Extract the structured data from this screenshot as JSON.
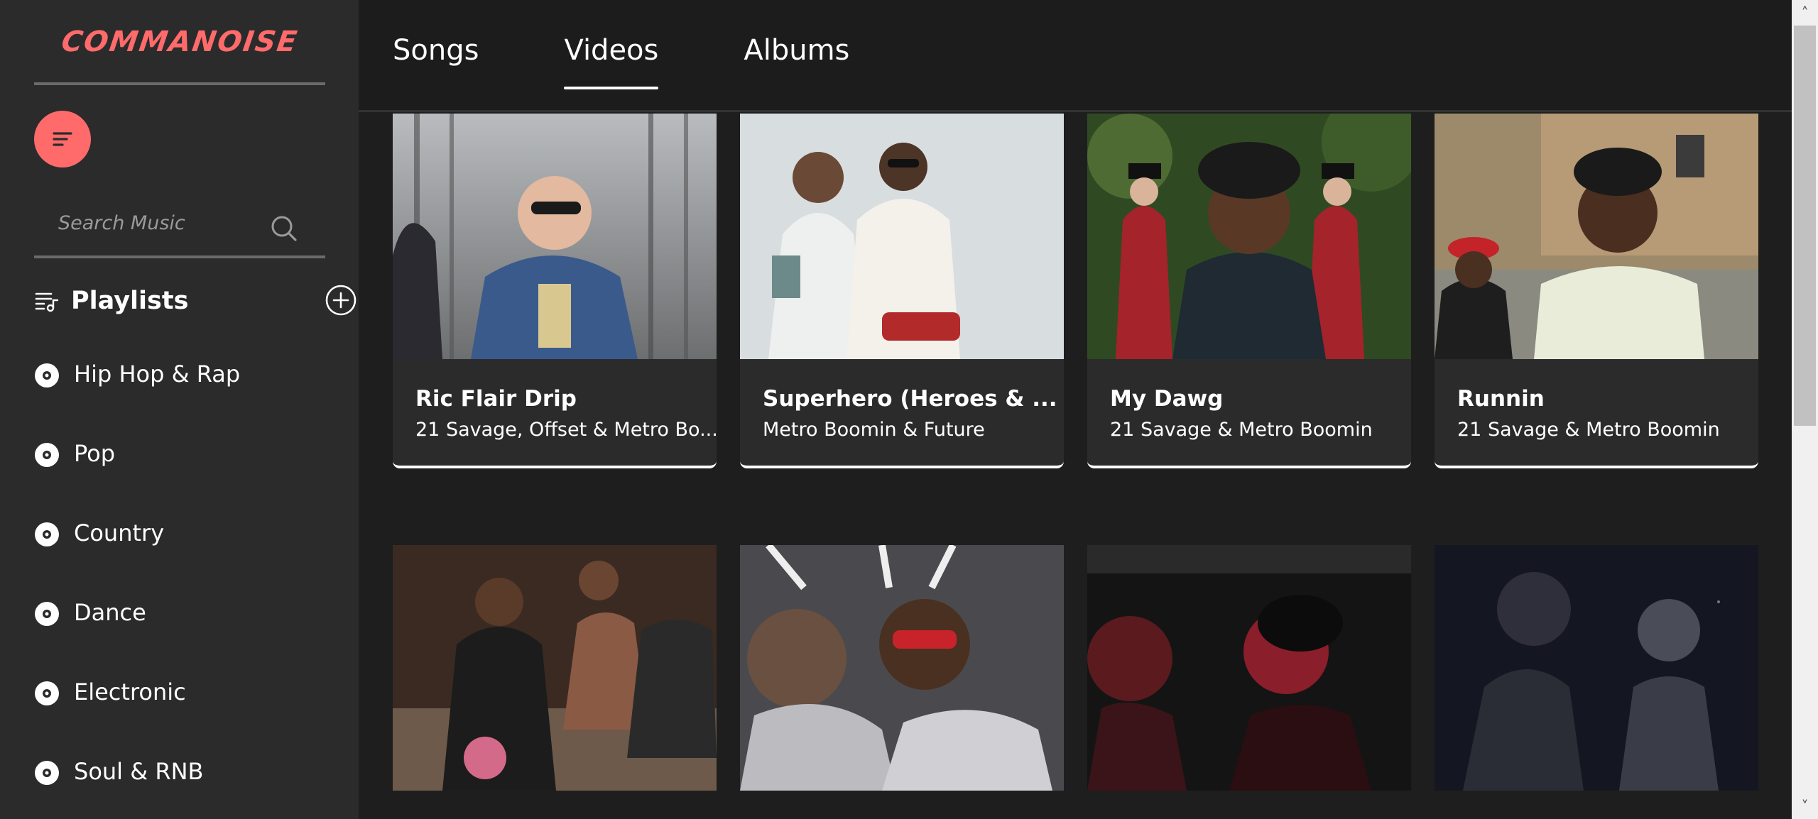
{
  "app": {
    "logo": "COMMANOISE",
    "brand_color": "#ff6b6b"
  },
  "search": {
    "placeholder": "Search Music"
  },
  "playlists": {
    "title": "Playlists",
    "items": [
      {
        "label": "Hip Hop & Rap"
      },
      {
        "label": "Pop"
      },
      {
        "label": "Country"
      },
      {
        "label": "Dance"
      },
      {
        "label": "Electronic"
      },
      {
        "label": "Soul & RNB"
      }
    ]
  },
  "tabs": [
    {
      "label": "Songs",
      "active": false
    },
    {
      "label": "Videos",
      "active": true
    },
    {
      "label": "Albums",
      "active": false
    }
  ],
  "videos": [
    {
      "title": "Ric Flair Drip",
      "artist": "21 Savage, Offset & Metro Bo..."
    },
    {
      "title": "Superhero (Heroes & ...",
      "artist": "Metro Boomin & Future"
    },
    {
      "title": "My Dawg",
      "artist": "21 Savage & Metro Boomin"
    },
    {
      "title": "Runnin",
      "artist": "21 Savage & Metro Boomin"
    }
  ],
  "icons": {
    "menu": "menu-lines-icon",
    "search": "search-icon",
    "playlist": "playlist-music-icon",
    "add": "add-circle-icon",
    "genre": "disc-icon"
  }
}
